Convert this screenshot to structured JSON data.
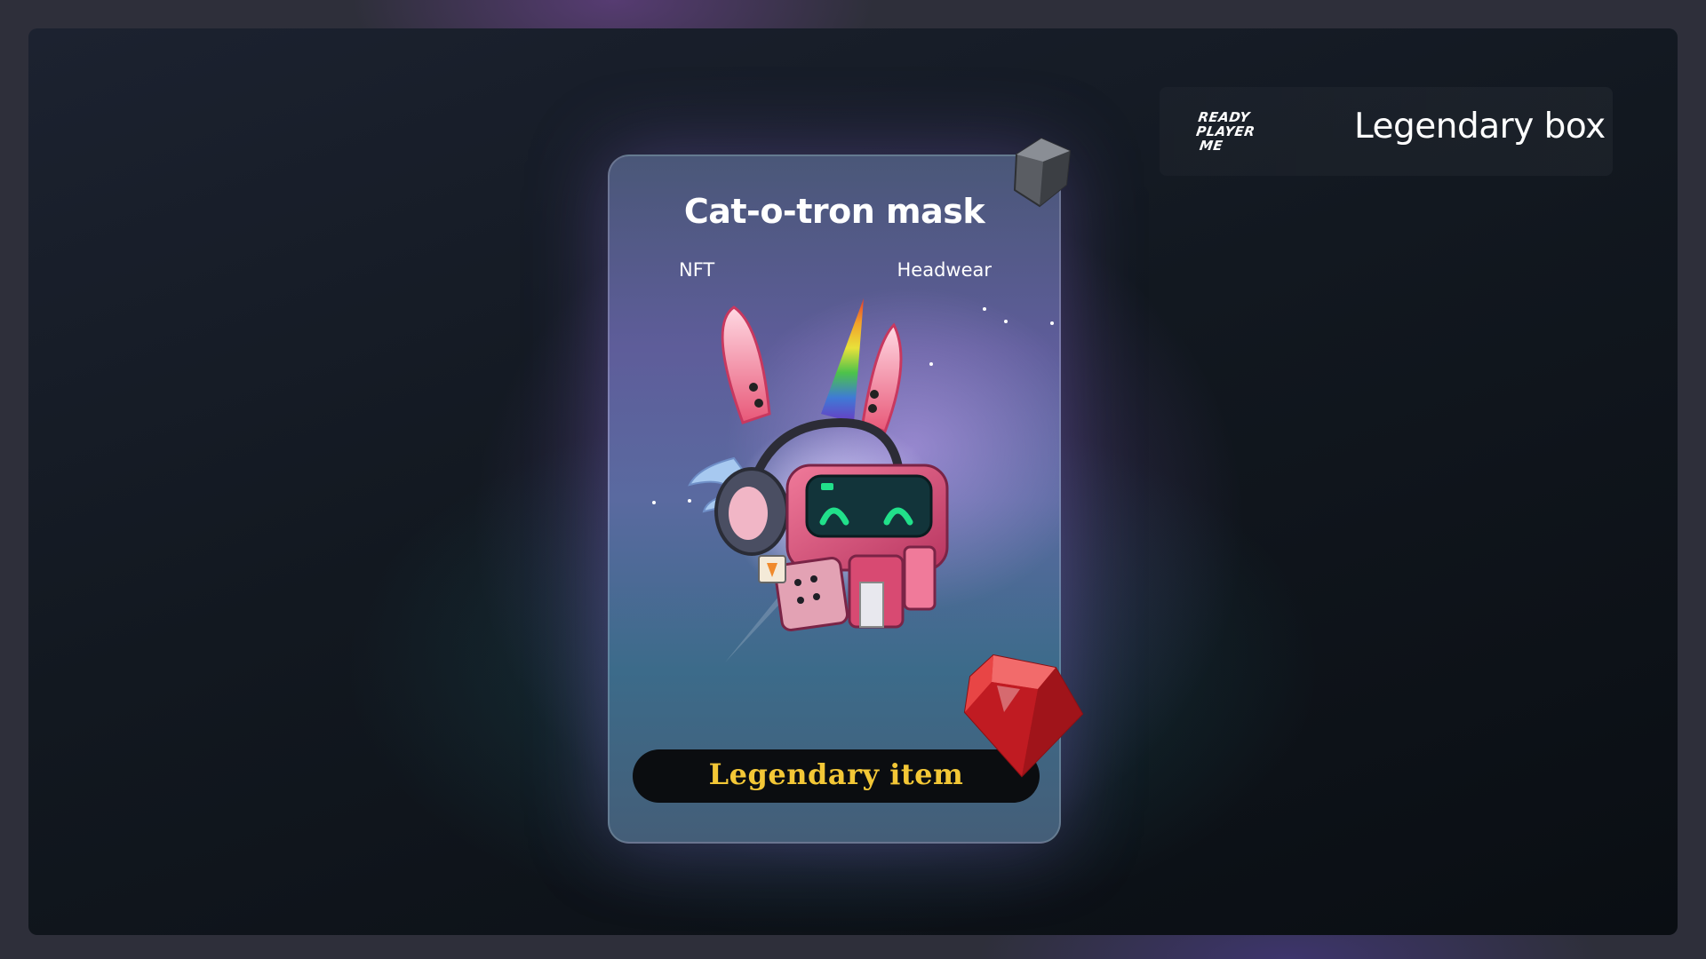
{
  "brand": {
    "logo_lines": [
      "READY",
      "PLAYER",
      "ME"
    ]
  },
  "box": {
    "title": "Legendary box"
  },
  "card": {
    "title": "Cat-o-tron mask",
    "tag_left": "NFT",
    "tag_right": "Headwear",
    "rarity": "Legendary item",
    "item_icon": "cat-o-tron-mask-icon"
  },
  "colors": {
    "rarity_text": "#f3c736",
    "rarity_pill_bg": "#0b0d10",
    "ruby": "#d3242a",
    "visor_glow": "#21e08a"
  }
}
